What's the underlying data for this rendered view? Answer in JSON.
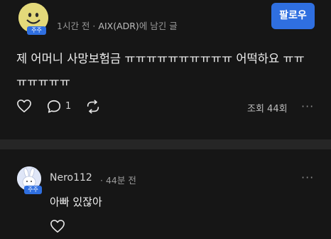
{
  "post": {
    "badge": "주주",
    "author_time": "1시간 전",
    "separator": "·",
    "author": "AIX(ADR)",
    "author_suffix": "에 남긴 글",
    "follow_label": "팔로우",
    "text": "제 어머니 사망보험금 ㅠㅠㅠㅠㅠㅠㅠㅠㅠㅠ 어떡하요 ㅠㅠㅠㅠㅠㅠㅠ",
    "reply_count": "1",
    "views": "조회 44회",
    "more": "···",
    "icons": {
      "like": "heart-icon",
      "comment": "chat-bubble-icon",
      "repost": "repost-icon",
      "avatar": "smiley-avatar"
    }
  },
  "comment": {
    "author": "Nero112",
    "time": "· 44분 전",
    "badge": "주주",
    "text": "아빠 있잖아",
    "more": "···",
    "icons": {
      "like": "heart-icon",
      "avatar": "rabbit-avatar"
    }
  },
  "colors": {
    "accent": "#2f6fe0",
    "background": "#161616",
    "separator": "#262626"
  }
}
